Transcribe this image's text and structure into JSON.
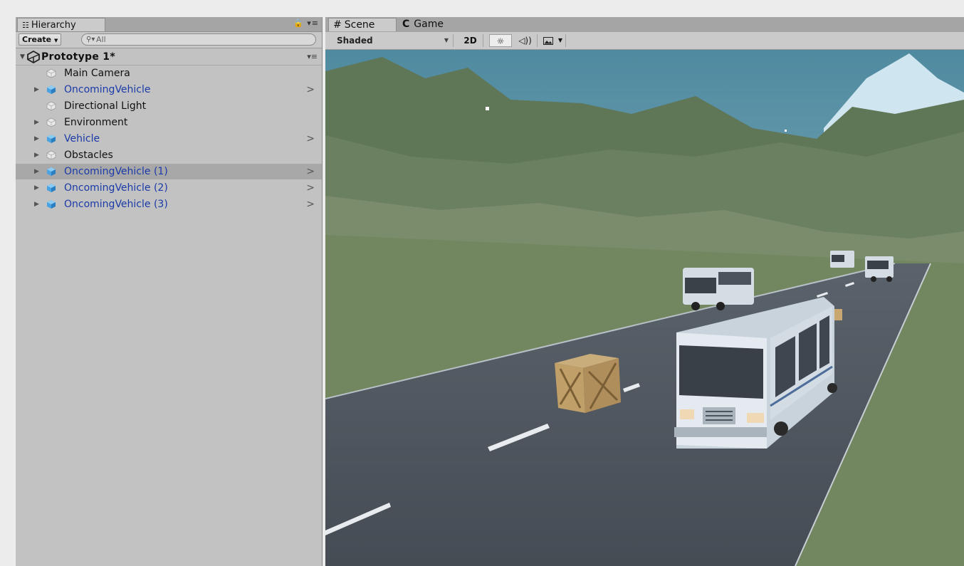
{
  "hierarchy": {
    "tab_label": "Hierarchy",
    "tab_icon": "list-icon",
    "create_label": "Create",
    "search_placeholder": "All",
    "scene_name": "Prototype 1*",
    "items": [
      {
        "label": "Main Camera",
        "prefab": false,
        "expandable": false,
        "chevron": false,
        "selected": false
      },
      {
        "label": "OncomingVehicle",
        "prefab": true,
        "expandable": true,
        "chevron": true,
        "selected": false
      },
      {
        "label": "Directional Light",
        "prefab": false,
        "expandable": false,
        "chevron": false,
        "selected": false
      },
      {
        "label": "Environment",
        "prefab": false,
        "expandable": true,
        "chevron": false,
        "selected": false
      },
      {
        "label": "Vehicle",
        "prefab": true,
        "expandable": true,
        "chevron": true,
        "selected": false
      },
      {
        "label": "Obstacles",
        "prefab": false,
        "expandable": true,
        "chevron": false,
        "selected": false
      },
      {
        "label": "OncomingVehicle (1)",
        "prefab": true,
        "expandable": true,
        "chevron": true,
        "selected": true
      },
      {
        "label": "OncomingVehicle (2)",
        "prefab": true,
        "expandable": true,
        "chevron": true,
        "selected": false
      },
      {
        "label": "OncomingVehicle (3)",
        "prefab": true,
        "expandable": true,
        "chevron": true,
        "selected": false
      }
    ]
  },
  "scene_view": {
    "tabs": [
      {
        "label": "Scene",
        "icon": "hash-icon",
        "active": true
      },
      {
        "label": "Game",
        "icon": "pacman-icon",
        "active": false
      }
    ],
    "shading_mode": "Shaded",
    "mode_2d_label": "2D"
  },
  "colors": {
    "prefab_text": "#1a3aa8",
    "panel_bg": "#c2c2c2",
    "selected_row": "#a8a8a8"
  }
}
